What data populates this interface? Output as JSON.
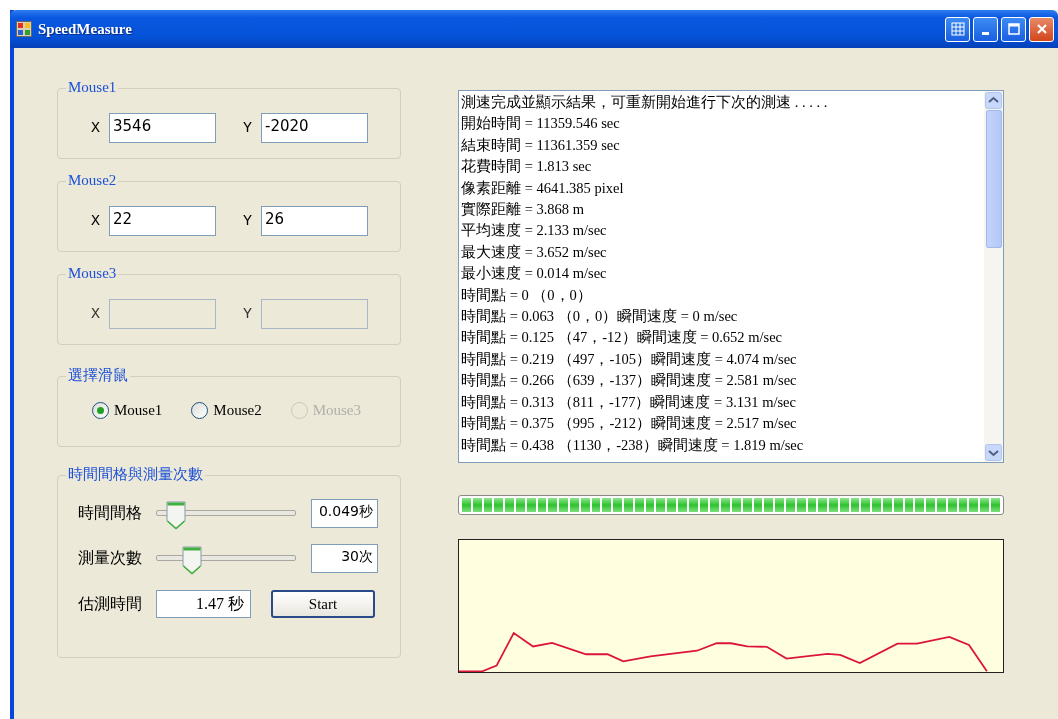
{
  "window": {
    "title": "SpeedMeasure"
  },
  "mouse_groups": [
    {
      "title": "Mouse1",
      "fields": [
        {
          "label": "X",
          "value": "3546",
          "disabled": false
        },
        {
          "label": "Y",
          "value": "-2020",
          "disabled": false
        }
      ]
    },
    {
      "title": "Mouse2",
      "fields": [
        {
          "label": "X",
          "value": "22",
          "disabled": false
        },
        {
          "label": "Y",
          "value": "26",
          "disabled": false
        }
      ]
    },
    {
      "title": "Mouse3",
      "fields": [
        {
          "label": "X",
          "disabled": true
        },
        {
          "label": "Y",
          "disabled": true
        }
      ]
    }
  ],
  "mouse_select": {
    "title": "選擇滑鼠",
    "options": [
      {
        "label": "Mouse1",
        "selected": true,
        "disabled": false
      },
      {
        "label": "Mouse2",
        "selected": false,
        "disabled": false
      },
      {
        "label": "Mouse3",
        "selected": false,
        "disabled": true
      }
    ]
  },
  "timing": {
    "title": "時間間格與測量次數",
    "sliders": [
      {
        "label": "時間間格",
        "level": 0.14,
        "reading": "0.049秒"
      },
      {
        "label": "測量次數",
        "level": 0.25,
        "reading": "30次"
      }
    ],
    "estimate": {
      "label": "估測時間",
      "value": "1.47 秒"
    },
    "start_button": "Start"
  },
  "log": {
    "lines": [
      "測速完成並顯示結果，可重新開始進行下次的測速 . . . . .",
      "開始時間 = 11359.546 sec",
      "結束時間 = 11361.359 sec",
      "花費時間 = 1.813 sec",
      "像素距離 = 4641.385 pixel",
      "實際距離 = 3.868 m",
      "平均速度 = 2.133 m/sec",
      "最大速度 = 3.652 m/sec",
      "最小速度 = 0.014 m/sec",
      "時間點 = 0 （0，0）",
      "時間點 = 0.063 （0，0）瞬間速度 = 0 m/sec",
      "時間點 = 0.125 （47，-12）瞬間速度 = 0.652 m/sec",
      "時間點 = 0.219 （497，-105）瞬間速度 = 4.074 m/sec",
      "時間點 = 0.266 （639，-137）瞬間速度 = 2.581 m/sec",
      "時間點 = 0.313 （811，-177）瞬間速度 = 3.131 m/sec",
      "時間點 = 0.375 （995，-212）瞬間速度 = 2.517 m/sec",
      "時間點 = 0.438 （1130，-238）瞬間速度 = 1.819 m/sec"
    ]
  },
  "progress": {
    "level": 1
  }
}
